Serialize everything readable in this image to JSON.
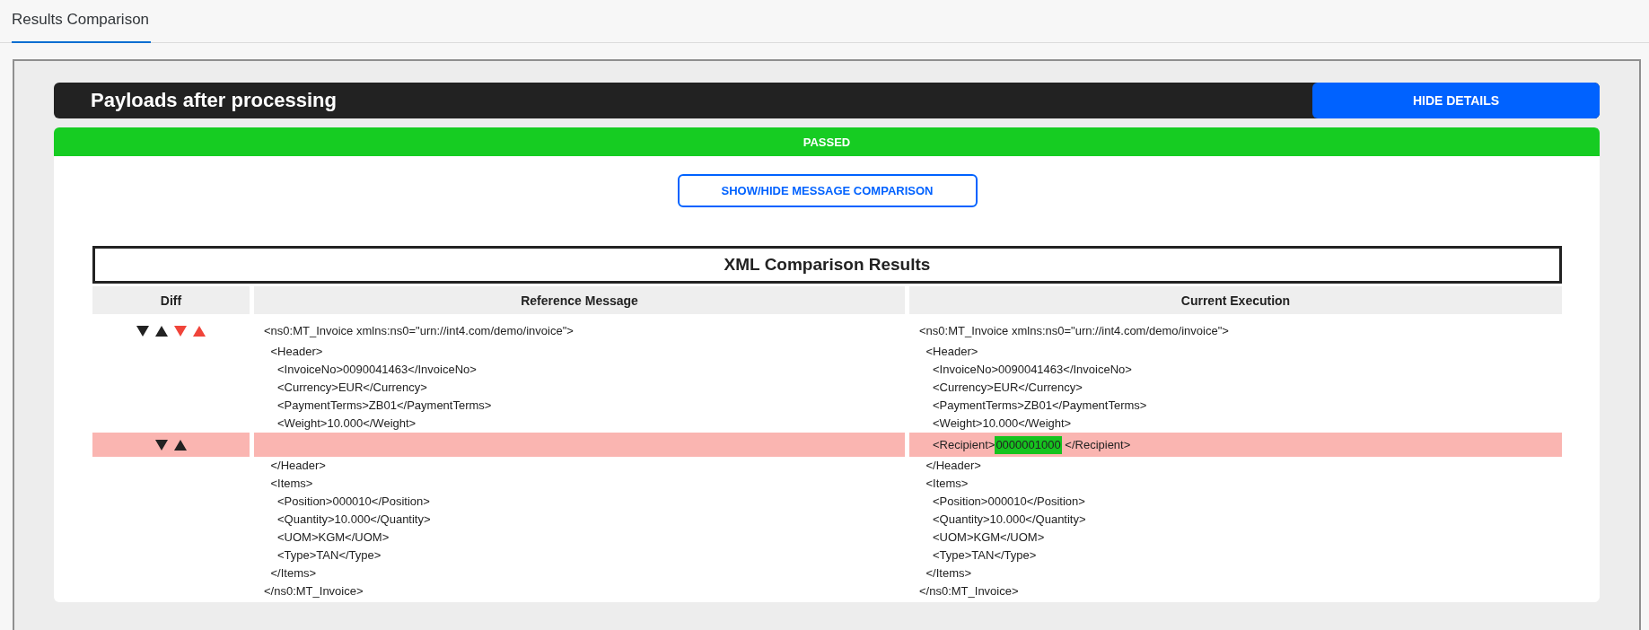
{
  "tabs": [
    {
      "label": "Results Comparison",
      "selected": true
    }
  ],
  "panel": {
    "title": "Payloads after processing",
    "toggle_button": "HIDE DETAILS",
    "status": {
      "label": "PASSED",
      "kind": "passed"
    },
    "comparison_button": "SHOW/HIDE MESSAGE COMPARISON",
    "comparison": {
      "title": "XML Comparison Results",
      "columns": [
        "Diff",
        "Reference Message",
        "Current Execution"
      ],
      "rows": [
        {
          "changed": false,
          "diff": [
            {
              "kind": "down",
              "color": "#222222"
            },
            {
              "kind": "up",
              "color": "#222222"
            },
            {
              "kind": "down",
              "color": "#f0443a"
            },
            {
              "kind": "up",
              "color": "#f0443a"
            }
          ],
          "reference": "<ns0:MT_Invoice xmlns:ns0=\"urn://int4.com/demo/invoice\">",
          "current": "<ns0:MT_Invoice xmlns:ns0=\"urn://int4.com/demo/invoice\">",
          "children": [
            {
              "changed": false,
              "reference": "<Header>",
              "current": "<Header>",
              "children": [
                {
                  "changed": false,
                  "reference": "<InvoiceNo>0090041463</InvoiceNo>",
                  "current": "<InvoiceNo>0090041463</InvoiceNo>"
                },
                {
                  "changed": false,
                  "reference": "<Currency>EUR</Currency>",
                  "current": "<Currency>EUR</Currency>"
                },
                {
                  "changed": false,
                  "reference": "<PaymentTerms>ZB01</PaymentTerms>",
                  "current": "<PaymentTerms>ZB01</PaymentTerms>"
                },
                {
                  "changed": false,
                  "reference": "<Weight>10.000</Weight>",
                  "current": "<Weight>10.000</Weight>"
                },
                {
                  "changed": true,
                  "diff": [
                    {
                      "kind": "down",
                      "color": "#222222"
                    },
                    {
                      "kind": "up",
                      "color": "#222222"
                    }
                  ],
                  "current": [
                    {
                      "text": "<Recipient>",
                      "highlighted": false
                    },
                    {
                      "text": "0000001000",
                      "highlighted": true
                    },
                    {
                      "text": " </Recipient>",
                      "highlighted": false
                    }
                  ]
                }
              ]
            },
            {
              "changed": false,
              "reference": "</Header>",
              "current": "</Header>"
            },
            {
              "changed": false,
              "reference": "<Items>",
              "current": "<Items>",
              "children": [
                {
                  "changed": false,
                  "reference": "<Position>000010</Position>",
                  "current": "<Position>000010</Position>"
                },
                {
                  "changed": false,
                  "reference": "<Quantity>10.000</Quantity>",
                  "current": "<Quantity>10.000</Quantity>"
                },
                {
                  "changed": false,
                  "reference": "<UOM>KGM</UOM>",
                  "current": "<UOM>KGM</UOM>"
                },
                {
                  "changed": false,
                  "reference": "<Type>TAN</Type>",
                  "current": "<Type>TAN</Type>"
                }
              ]
            },
            {
              "changed": false,
              "reference": "</Items>",
              "current": "</Items>"
            }
          ]
        },
        {
          "changed": false,
          "reference": "</ns0:MT_Invoice>",
          "current": "</ns0:MT_Invoice>"
        }
      ]
    }
  }
}
